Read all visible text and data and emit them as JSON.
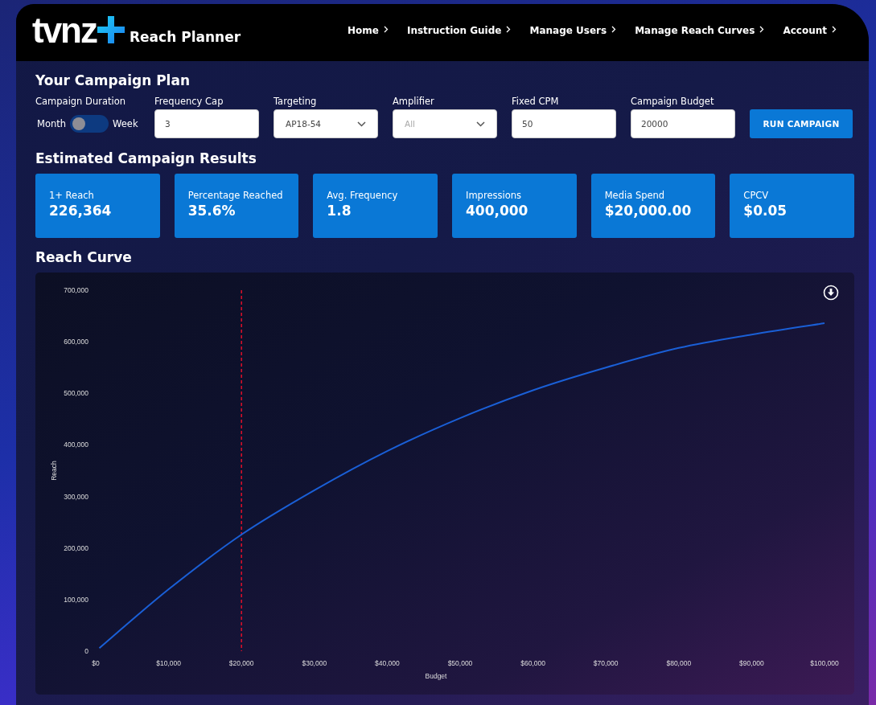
{
  "header": {
    "logo_text": "tvnz",
    "app_title": "Reach Planner",
    "nav": [
      {
        "label": "Home"
      },
      {
        "label": "Instruction Guide"
      },
      {
        "label": "Manage Users"
      },
      {
        "label": "Manage Reach Curves"
      },
      {
        "label": "Account"
      }
    ]
  },
  "plan": {
    "title": "Your Campaign Plan",
    "duration": {
      "label": "Campaign Duration",
      "left": "Month",
      "right": "Week",
      "on": false
    },
    "fields": [
      {
        "kind": "input",
        "label": "Frequency Cap",
        "value": "3"
      },
      {
        "kind": "select",
        "label": "Targeting",
        "value": "AP18-54"
      },
      {
        "kind": "select",
        "label": "Amplifier",
        "placeholder": "All"
      },
      {
        "kind": "input",
        "label": "Fixed CPM",
        "value": "50"
      },
      {
        "kind": "input",
        "label": "Campaign Budget",
        "value": "20000"
      }
    ],
    "button": "RUN CAMPAIGN"
  },
  "results": {
    "title": "Estimated Campaign Results",
    "cards": [
      {
        "label": "1+ Reach",
        "value": "226,364"
      },
      {
        "label": "Percentage Reached",
        "value": "35.6%"
      },
      {
        "label": "Avg. Frequency",
        "value": "1.8"
      },
      {
        "label": "Impressions",
        "value": "400,000"
      },
      {
        "label": "Media Spend",
        "value": "$20,000.00"
      },
      {
        "label": "CPCV",
        "value": "$0.05"
      }
    ]
  },
  "reach_curve": {
    "title": "Reach Curve",
    "chart_data": {
      "type": "line",
      "xlabel": "Budget",
      "ylabel": "Reach",
      "x": [
        500,
        10000,
        20000,
        30000,
        40000,
        50000,
        60000,
        70000,
        80000,
        90000,
        100000
      ],
      "series": [
        {
          "color": "#1a5fd6",
          "values": [
            6000,
            120000,
            226000,
            312000,
            388000,
            452000,
            506000,
            550000,
            588000,
            614000,
            636000
          ]
        }
      ],
      "xlim": [
        0,
        100000
      ],
      "ylim": [
        0,
        700000
      ],
      "xticks": [
        {
          "value": 0,
          "label": "$0"
        },
        {
          "value": 10000,
          "label": "$10,000"
        },
        {
          "value": 20000,
          "label": "$20,000"
        },
        {
          "value": 30000,
          "label": "$30,000"
        },
        {
          "value": 40000,
          "label": "$40,000"
        },
        {
          "value": 50000,
          "label": "$50,000"
        },
        {
          "value": 60000,
          "label": "$60,000"
        },
        {
          "value": 70000,
          "label": "$70,000"
        },
        {
          "value": 80000,
          "label": "$80,000"
        },
        {
          "value": 90000,
          "label": "$90,000"
        },
        {
          "value": 100000,
          "label": "$100,000"
        }
      ],
      "yticks": [
        {
          "value": 0,
          "label": "0"
        },
        {
          "value": 100000,
          "label": "100,000"
        },
        {
          "value": 200000,
          "label": "200,000"
        },
        {
          "value": 300000,
          "label": "300,000"
        },
        {
          "value": 400000,
          "label": "400,000"
        },
        {
          "value": 500000,
          "label": "500,000"
        },
        {
          "value": 600000,
          "label": "600,000"
        },
        {
          "value": 700000,
          "label": "700,000"
        }
      ],
      "ref_lines": [
        {
          "axis": "x",
          "value": 20000,
          "color": "#e0102a"
        }
      ]
    }
  }
}
